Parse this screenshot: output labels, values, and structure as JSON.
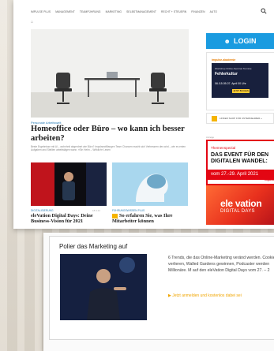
{
  "nav": {
    "items": [
      "IMPULSE PLUS",
      "MANAGEMENT",
      "TEAMFÜHRUNG",
      "MARKETING",
      "SELBSTMANAGEMENT",
      "RECHT + STEUERN",
      "FINANZEN",
      "AUTO"
    ]
  },
  "article": {
    "kicker": "Personale Arbeitswelt",
    "headline": "Homeoffice oder Büro – wo kann ich besser arbeiten?",
    "teaser": "Beste Ergebnisse mit Al – wohnhnit abgerdnet wie Büro? Impulsewilflangen Team Chancen macht sich Verbessern des wird – wie es enten Aufgaben and Stelllen arbeitstägen wann. »Ein Hehn – Wirklich« Lesen"
  },
  "cards": [
    {
      "kicker": "DIGITALISIERUNG",
      "date": "18.3.21",
      "title": "eleVation Digital Days: Deine Business-Vision für 2021"
    },
    {
      "kicker": "FÜHRUNGSWISSEN PLUS",
      "title": "So erfahren Sie, was Ihre Mitarbeiter können"
    }
  ],
  "sidebar": {
    "login_label": "LOGIN",
    "ad1": {
      "tag": "impulse-akademie",
      "line1": "Workshop Online-Seminar Termine",
      "title": "Fehlerkultur",
      "date": "06./15.05.07. April 00 Uhr",
      "button": "JETZT BUCHEN"
    },
    "strip_text": "LINKER SHOP FÜR UNTERNEHMER »",
    "ad2": {
      "label": "Anzeige",
      "theme": "Themenspezial",
      "big": "DAS EVENT FÜR DEN DIGITALEN WANDEL:",
      "dates": "vom 27.-29. April 2021",
      "logo": "impulse",
      "brand": "ele vation",
      "brand_sub": "DIGITAL DAYS"
    }
  },
  "print2": {
    "title": "Polier das Marketing auf",
    "text": "6 Trends, die das Online-Marketing veränd werden. Cookies verlieren, Walled Gardens gewinnen, Podcaster werden Millionäre. M auf den eleVation Digital Days vom 27. – 2",
    "cta": "Jetzt anmelden und kostenlos dabei sei"
  },
  "colors": {
    "accent": "#1a9be0",
    "red": "#e30613",
    "link": "#2c7fb8",
    "cta": "#f0a500"
  }
}
